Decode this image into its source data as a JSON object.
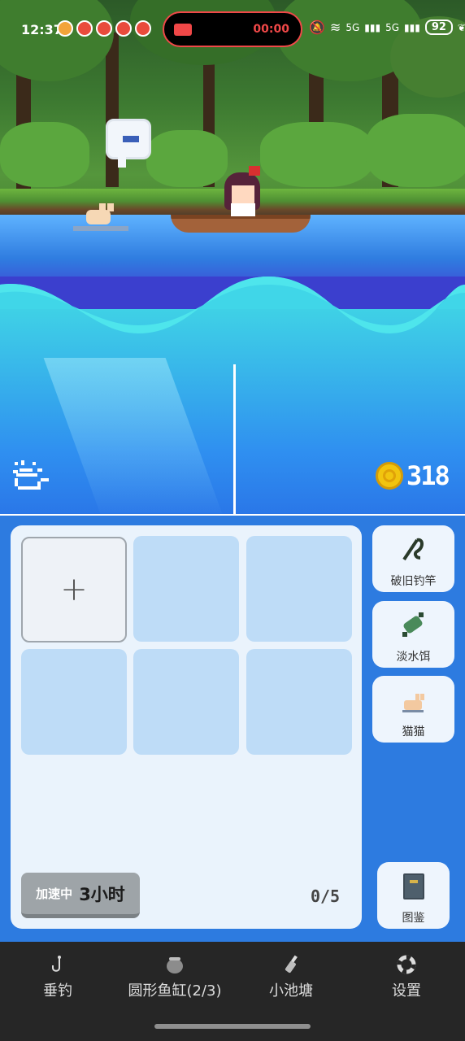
{
  "status_bar": {
    "time": "12:37",
    "recording_time": "00:00",
    "network_1": "5G",
    "network_2": "5G",
    "battery": "92"
  },
  "hud": {
    "coins": "318",
    "weather_icon": "sun-cloud-icon"
  },
  "inventory": {
    "add_slot_icon": "+",
    "speed_label": "加速中",
    "speed_value": "3小时",
    "capacity": "0/5"
  },
  "side_panel": {
    "rod_label": "破旧钓竿",
    "bait_label": "淡水饵",
    "pet_label": "猫猫",
    "guide_label": "图鉴"
  },
  "nav": {
    "items": [
      {
        "label": "垂钓",
        "icon": "fishhook-icon"
      },
      {
        "label": "圆形鱼缸(2/3)",
        "icon": "fishbowl-icon"
      },
      {
        "label": "小池塘",
        "icon": "bottle-icon"
      },
      {
        "label": "设置",
        "icon": "lifebuoy-icon"
      }
    ]
  },
  "colors": {
    "panel_blue": "#2d7be0",
    "slot_blue": "#bedcf7",
    "coin_gold": "#f1c40f",
    "nav_bg": "#262626"
  }
}
